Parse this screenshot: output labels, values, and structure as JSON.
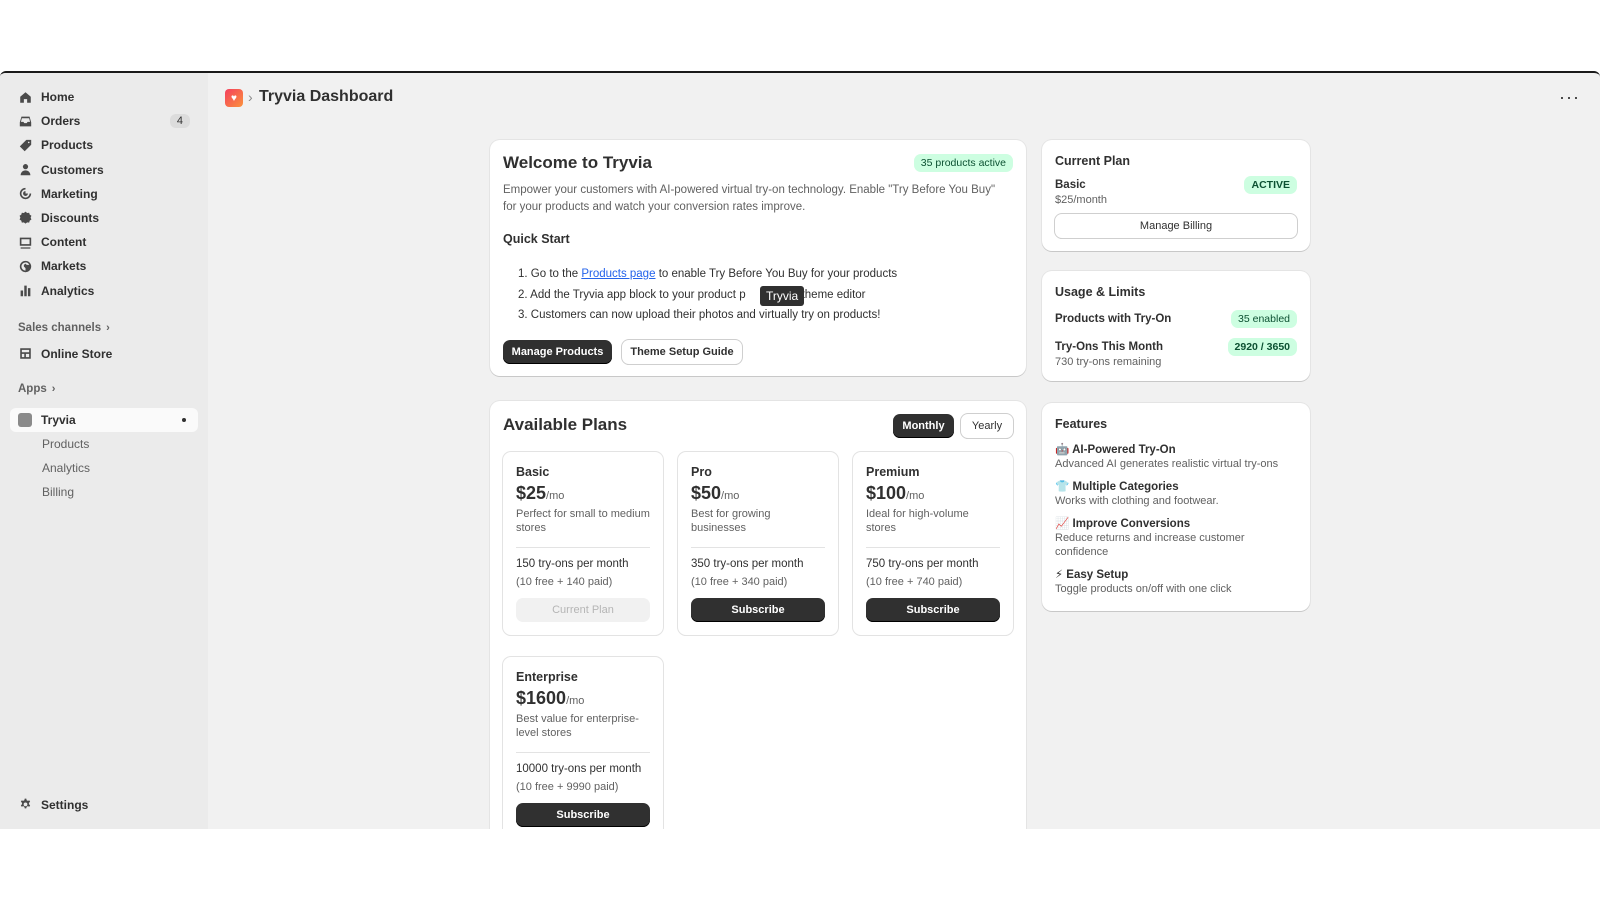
{
  "sidebar": {
    "items": [
      {
        "label": "Home",
        "icon": "home-icon"
      },
      {
        "label": "Orders",
        "icon": "inbox-icon",
        "count": "4"
      },
      {
        "label": "Products",
        "icon": "tag-icon"
      },
      {
        "label": "Customers",
        "icon": "person-icon"
      },
      {
        "label": "Marketing",
        "icon": "target-icon"
      },
      {
        "label": "Discounts",
        "icon": "discount-icon"
      },
      {
        "label": "Content",
        "icon": "content-icon"
      },
      {
        "label": "Markets",
        "icon": "globe-icon"
      },
      {
        "label": "Analytics",
        "icon": "bar-chart-icon"
      }
    ],
    "sales_channels_label": "Sales channels",
    "online_store_label": "Online Store",
    "apps_label": "Apps",
    "app_name": "Tryvia",
    "app_sub_items": [
      "Products",
      "Analytics",
      "Billing"
    ],
    "settings_label": "Settings"
  },
  "header": {
    "title": "Tryvia Dashboard",
    "breadcrumb_sep": "›",
    "more": "···"
  },
  "welcome": {
    "title": "Welcome to Tryvia",
    "badge": "35 products active",
    "description": "Empower your customers with AI-powered virtual try-on technology. Enable \"Try Before You Buy\" for your products and watch your conversion rates improve.",
    "quick_start_title": "Quick Start",
    "step1_num": "1.",
    "step1_pre": "Go to the",
    "step1_link": "Products page",
    "step1_post": "to enable Try Before You Buy for your products",
    "step2_num": "2.",
    "step2_pre": "Add the Tryvia app block to your product p",
    "step2_post": "he theme editor",
    "step3_num": "3.",
    "step3": "Customers can now upload their photos and virtually try on products!",
    "manage_products_btn": "Manage Products",
    "theme_guide_btn": "Theme Setup Guide",
    "tooltip": "Tryvia"
  },
  "plans": {
    "title": "Available Plans",
    "toggle_monthly": "Monthly",
    "toggle_yearly": "Yearly",
    "items": [
      {
        "name": "Basic",
        "price": "$25",
        "per": "/mo",
        "desc": "Perfect for small to medium stores",
        "quota": "150 try-ons per month",
        "split": "(10 free + 140 paid)",
        "button": "Current Plan"
      },
      {
        "name": "Pro",
        "price": "$50",
        "per": "/mo",
        "desc": "Best for growing businesses",
        "quota": "350 try-ons per month",
        "split": "(10 free + 340 paid)",
        "button": "Subscribe"
      },
      {
        "name": "Premium",
        "price": "$100",
        "per": "/mo",
        "desc": "Ideal for high-volume stores",
        "quota": "750 try-ons per month",
        "split": "(10 free + 740 paid)",
        "button": "Subscribe"
      },
      {
        "name": "Enterprise",
        "price": "$1600",
        "per": "/mo",
        "desc": "Best value for enterprise-level stores",
        "quota": "10000 try-ons per month",
        "split": "(10 free + 9990 paid)",
        "button": "Subscribe"
      }
    ]
  },
  "current_plan": {
    "title": "Current Plan",
    "name": "Basic",
    "price": "$25/month",
    "status": "ACTIVE",
    "manage_billing_btn": "Manage Billing"
  },
  "usage": {
    "title": "Usage & Limits",
    "products_label": "Products with Try-On",
    "products_value": "35 enabled",
    "tryons_label": "Try-Ons This Month",
    "tryons_value": "2920 / 3650",
    "remaining": "730 try-ons remaining"
  },
  "features": {
    "title": "Features",
    "items": [
      {
        "emoji": "🤖",
        "title": "AI-Powered Try-On",
        "desc": "Advanced AI generates realistic virtual try-ons"
      },
      {
        "emoji": "👕",
        "title": "Multiple Categories",
        "desc": "Works with clothing and footwear."
      },
      {
        "emoji": "📈",
        "title": "Improve Conversions",
        "desc": "Reduce returns and increase customer confidence"
      },
      {
        "emoji": "⚡",
        "title": "Easy Setup",
        "desc": "Toggle products on/off with one click"
      }
    ]
  },
  "colors": {
    "accent_dark": "#303030",
    "success_bg": "#cdfee1",
    "success_text": "#0c5132",
    "link": "#2463eb"
  }
}
